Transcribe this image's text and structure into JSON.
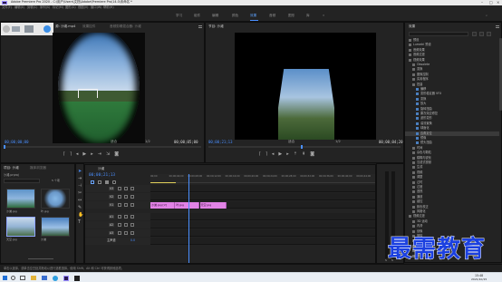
{
  "window": {
    "title": "Adobe Premiere Pro 2020 - C:\\用户\\Users\\文档\\Adobe\\Premiere Pro\\14.0\\未命名 *",
    "minimize_icon": "minimize-icon",
    "maximize_icon": "maximize-icon",
    "close_icon": "close-icon"
  },
  "menu": [
    "文件(F)",
    "编辑(E)",
    "剪辑(C)",
    "序列(S)",
    "标记(M)",
    "图形(G)",
    "视图(V)",
    "窗口(W)",
    "帮助(H)"
  ],
  "workspaces": {
    "items": [
      "学习",
      "组件",
      "编辑",
      "颜色",
      "效果",
      "音频",
      "图形",
      "库"
    ],
    "active_index": 4
  },
  "source_monitor": {
    "tabs": [
      "源: 沙滩.mp4",
      "效果控件",
      "音频剪辑混合器: 沙滩"
    ],
    "timecode_left": "00;00;00;00",
    "timecode_right": "00;00;05;00",
    "fit": "适合",
    "fraction": "1/2"
  },
  "program_monitor": {
    "tab": "节目: 沙滩",
    "timecode_left": "00;00;21;13",
    "timecode_right": "00;00;04;20",
    "fit": "适合",
    "fraction": "1/2"
  },
  "project": {
    "tabs": [
      "项目: 沙滩",
      "媒体浏览器"
    ],
    "name": "沙滩.prproj",
    "count": "5 个项",
    "items": [
      {
        "name": "沙滩.jpg",
        "duration": "5;00"
      },
      {
        "name": "叶.jpg",
        "duration": "5;00"
      },
      {
        "name": "天空.jpg",
        "duration": "5;00"
      },
      {
        "name": "沙滩",
        "duration": "5;00"
      }
    ]
  },
  "timeline": {
    "tab": "沙滩",
    "timecode": "00;00;21;13",
    "ruler": [
      "00;00",
      "00;00;04;00",
      "00;00;08;00",
      "00;00;12;00",
      "00;00;16;00",
      "00;00;20;00",
      "00;00;24;00",
      "00;00;28;00",
      "00;00;32;00",
      "00;00;36;00",
      "00;00;40;00",
      "00;00;44;00"
    ],
    "video_tracks": [
      "V3",
      "V2",
      "V1"
    ],
    "audio_tracks": [
      "A1",
      "A2",
      "A3"
    ],
    "master": "主声道",
    "master_value": "0.0",
    "clips": [
      {
        "label": "沙滩.jpg [V]",
        "start_frac": 0.0,
        "end_frac": 0.11
      },
      {
        "label": "叶.jpg",
        "start_frac": 0.11,
        "end_frac": 0.22
      },
      {
        "label": "天空.jpg",
        "start_frac": 0.22,
        "end_frac": 0.34
      }
    ],
    "playhead_frac": 0.17
  },
  "effects": {
    "tab": "效果",
    "search_placeholder": "",
    "tree": [
      {
        "label": "预设",
        "depth": 0
      },
      {
        "label": "Lumetri 预设",
        "depth": 0
      },
      {
        "label": "音频效果",
        "depth": 0
      },
      {
        "label": "音频过渡",
        "depth": 0
      },
      {
        "label": "视频效果",
        "depth": 0
      },
      {
        "label": "Obsolete",
        "depth": 1
      },
      {
        "label": "变换",
        "depth": 1
      },
      {
        "label": "图像控制",
        "depth": 1
      },
      {
        "label": "实用程序",
        "depth": 1
      },
      {
        "label": "扭曲",
        "depth": 1
      },
      {
        "label": "偏移",
        "depth": 2
      },
      {
        "label": "变形稳定器 VFX",
        "depth": 2
      },
      {
        "label": "变换",
        "depth": 2
      },
      {
        "label": "放大",
        "depth": 2
      },
      {
        "label": "旋转扭曲",
        "depth": 2
      },
      {
        "label": "果冻效应修复",
        "depth": 2
      },
      {
        "label": "波形变形",
        "depth": 2
      },
      {
        "label": "湍流置换",
        "depth": 2
      },
      {
        "label": "球面化",
        "depth": 2
      },
      {
        "label": "边角定位",
        "depth": 2,
        "selected": true
      },
      {
        "label": "镜像",
        "depth": 2
      },
      {
        "label": "镜头扭曲",
        "depth": 2
      },
      {
        "label": "时间",
        "depth": 1
      },
      {
        "label": "杂色与颗粒",
        "depth": 1
      },
      {
        "label": "模糊与锐化",
        "depth": 1
      },
      {
        "label": "沉浸式视频",
        "depth": 1
      },
      {
        "label": "生成",
        "depth": 1
      },
      {
        "label": "视频",
        "depth": 1
      },
      {
        "label": "调整",
        "depth": 1
      },
      {
        "label": "过时",
        "depth": 1
      },
      {
        "label": "过渡",
        "depth": 1
      },
      {
        "label": "透视",
        "depth": 1
      },
      {
        "label": "通道",
        "depth": 1
      },
      {
        "label": "键控",
        "depth": 1
      },
      {
        "label": "颜色校正",
        "depth": 1
      },
      {
        "label": "风格化",
        "depth": 1
      },
      {
        "label": "视频过渡",
        "depth": 0
      },
      {
        "label": "3D 运动",
        "depth": 1
      },
      {
        "label": "内滑",
        "depth": 1
      },
      {
        "label": "划像",
        "depth": 1
      },
      {
        "label": "擦除",
        "depth": 1
      },
      {
        "label": "沉浸式视频",
        "depth": 1
      },
      {
        "label": "溶解",
        "depth": 1
      },
      {
        "label": "缩放",
        "depth": 1
      },
      {
        "label": "页面剥落",
        "depth": 1
      }
    ]
  },
  "status": "单击以选择，或单击空白处并拖动以进行选框选择。使用 Shift、Alt 和 Ctrl 可获得其他选项。",
  "taskbar": {
    "time": "15:48",
    "date": "2021/10/15"
  },
  "watermark": "最需教育",
  "colors": {
    "accent": "#4a8fff",
    "clip": "#e283e6",
    "watermark": "#1b40e0"
  }
}
